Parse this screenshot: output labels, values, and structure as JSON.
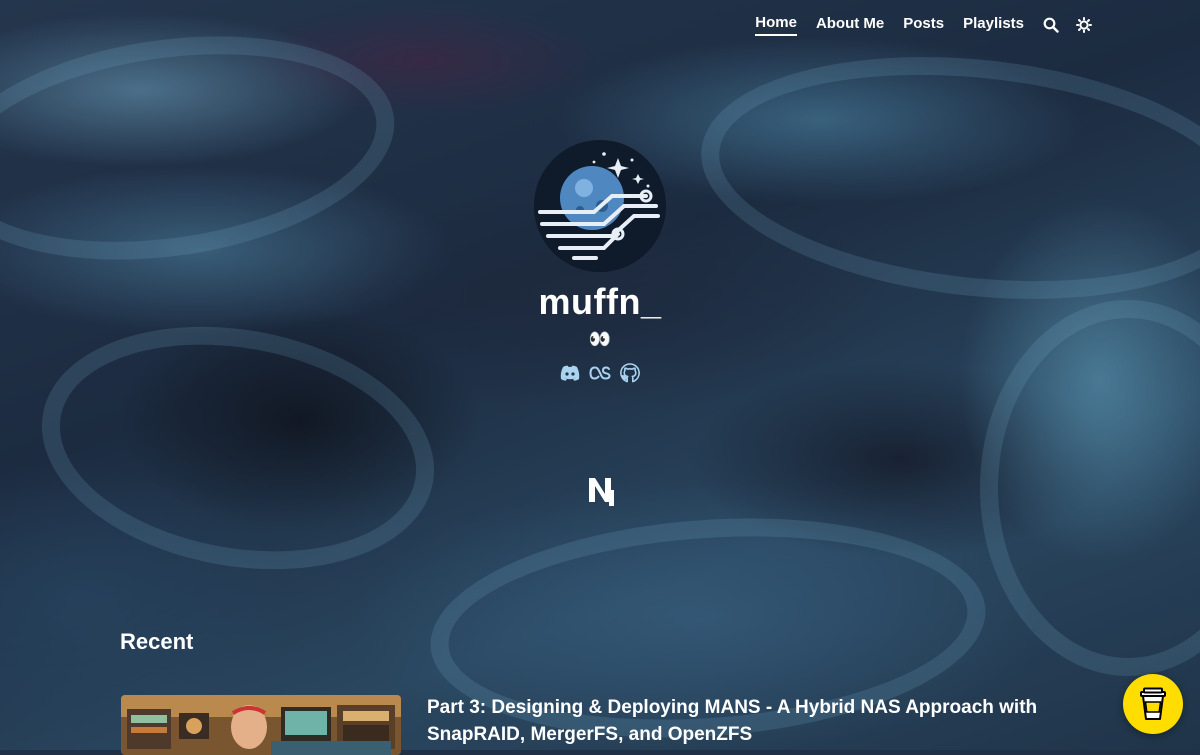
{
  "nav": {
    "items": [
      {
        "label": "Home",
        "active": true
      },
      {
        "label": "About Me",
        "active": false
      },
      {
        "label": "Posts",
        "active": false
      },
      {
        "label": "Playlists",
        "active": false
      }
    ],
    "search_icon": "search-icon",
    "theme_icon": "sun-icon"
  },
  "hero": {
    "avatar_icon": "planet-circuit-logo",
    "title": "muffn_",
    "subtitle": "👀",
    "socials": [
      "discord-icon",
      "lastfm-icon",
      "github-icon"
    ]
  },
  "logo_mark": "n-cursor-logo",
  "recent": {
    "heading": "Recent",
    "posts": [
      {
        "title": "Part 3: Designing & Deploying MANS - A Hybrid NAS Approach with SnapRAID, MergerFS, and OpenZFS"
      }
    ]
  },
  "coffee_button_icon": "coffee-cup-icon",
  "colors": {
    "accent": "#ffdd00",
    "text": "#ffffff",
    "background": "#1f3047"
  }
}
